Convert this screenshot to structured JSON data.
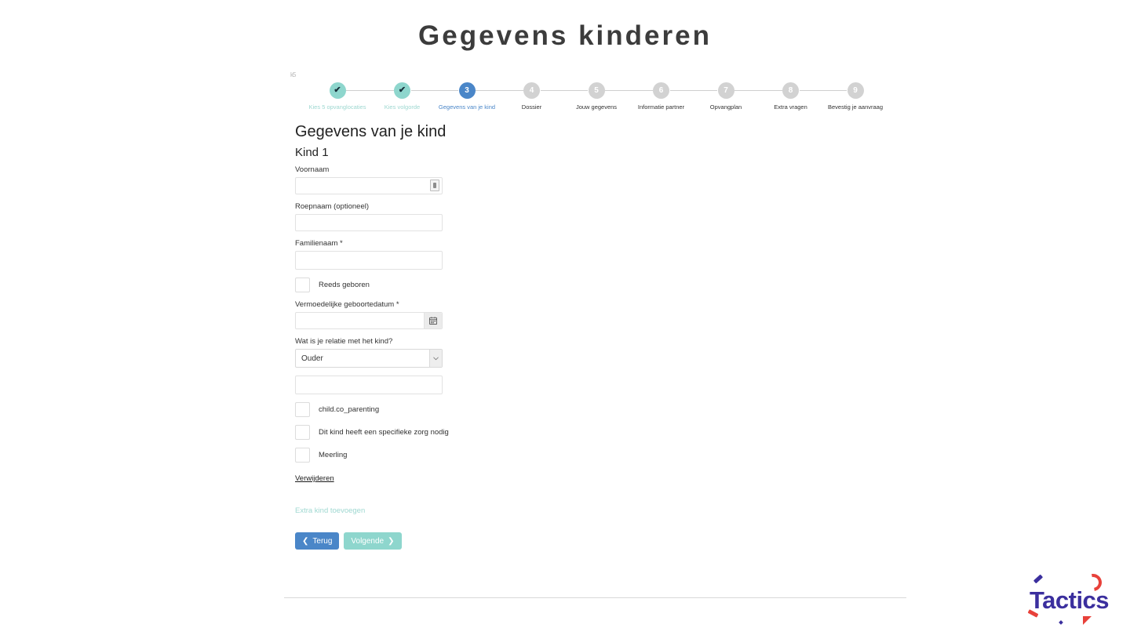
{
  "slide": {
    "title": "Gegevens kinderen"
  },
  "screenshot": {
    "corner_artifact": "k5",
    "stepper": {
      "steps": [
        {
          "number": "1",
          "label": "Kies 5 opvanglocaties",
          "state": "done",
          "glyph": "✔"
        },
        {
          "number": "2",
          "label": "Kies volgorde",
          "state": "done",
          "glyph": "✔"
        },
        {
          "number": "3",
          "label": "Gegevens van je kind",
          "state": "current",
          "glyph": "3"
        },
        {
          "number": "4",
          "label": "Dossier",
          "state": "todo",
          "glyph": "4"
        },
        {
          "number": "5",
          "label": "Jouw gegevens",
          "state": "todo",
          "glyph": "5"
        },
        {
          "number": "6",
          "label": "Informatie partner",
          "state": "todo",
          "glyph": "6"
        },
        {
          "number": "7",
          "label": "Opvangplan",
          "state": "todo",
          "glyph": "7"
        },
        {
          "number": "8",
          "label": "Extra vragen",
          "state": "todo",
          "glyph": "8"
        },
        {
          "number": "9",
          "label": "Bevestig je aanvraag",
          "state": "todo",
          "glyph": "9"
        }
      ]
    },
    "form": {
      "heading": "Gegevens van je kind",
      "subheading": "Kind 1",
      "fields": {
        "voornaam_label": "Voornaam",
        "voornaam_value": "",
        "roepnaam_label": "Roepnaam (optioneel)",
        "roepnaam_value": "",
        "familienaam_label": "Familienaam *",
        "familienaam_value": "",
        "geboortedatum_label": "Vermoedelijke geboortedatum *",
        "geboortedatum_value": "",
        "relatie_label": "Wat is je relatie met het kind?",
        "relatie_value": "Ouder",
        "extra_value": ""
      },
      "checkboxes": [
        {
          "label": "Reeds geboren",
          "checked": false
        },
        {
          "label": "child.co_parenting",
          "checked": false
        },
        {
          "label": "Dit kind heeft een specifieke zorg nodig",
          "checked": false
        },
        {
          "label": "Meerling",
          "checked": false
        }
      ],
      "remove_link": "Verwijderen",
      "add_child_link": "Extra kind toevoegen",
      "back_button": "Terug",
      "next_button": "Volgende",
      "back_arrow": "❮",
      "next_arrow": "❯",
      "calendar_icon": "Ὄ5",
      "select_arrow": "˅"
    }
  },
  "logo": {
    "wordmark": "Tactics"
  },
  "colors": {
    "done": "#8ed6cd",
    "current": "#4a86c8",
    "todo": "#d2d2d2",
    "brand_purple": "#3b2f9e",
    "brand_red": "#e8413a"
  }
}
